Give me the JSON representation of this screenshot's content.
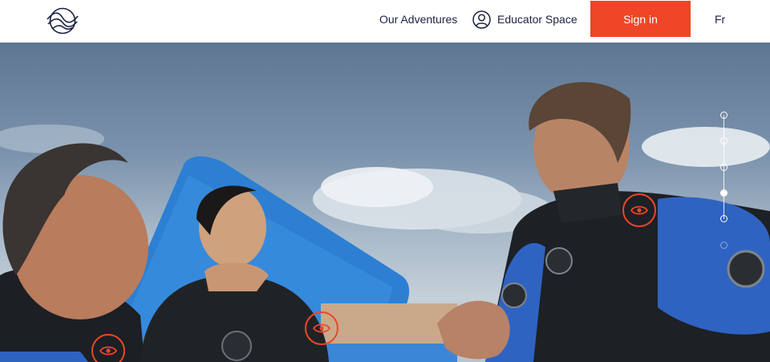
{
  "header": {
    "logo_icon": "wave-circle-logo-icon",
    "nav": {
      "adventures_label": "Our Adventures",
      "educator_label": "Educator Space",
      "educator_icon": "user-circle-icon"
    },
    "signin_label": "Sign in",
    "language_label": "Fr"
  },
  "hero": {
    "hotspot_icon": "eye-icon",
    "hotspot_count": 3,
    "pager": {
      "total_slides": 6,
      "active_index": 3
    }
  },
  "colors": {
    "accent": "#ee4626",
    "text": "#1b2240",
    "header_bg": "#ffffff"
  }
}
